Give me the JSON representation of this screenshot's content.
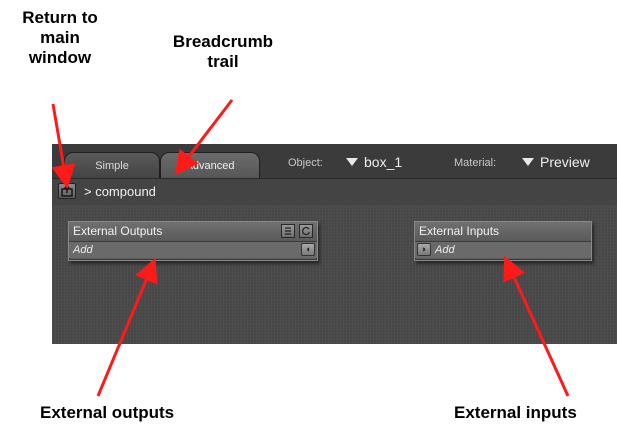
{
  "callouts": {
    "return_to_main": "Return to\nmain\nwindow",
    "breadcrumb_trail": "Breadcrumb\ntrail",
    "external_outputs": "External outputs",
    "external_inputs": "External inputs"
  },
  "toolbar": {
    "tabs": [
      {
        "label": "Simple"
      },
      {
        "label": "Advanced"
      }
    ],
    "object_label": "Object:",
    "object_value": "box_1",
    "material_label": "Material:",
    "material_value": "Preview"
  },
  "breadcrumb": {
    "text": "> compound"
  },
  "nodes": {
    "external_outputs": {
      "title": "External Outputs",
      "row_label": "Add"
    },
    "external_inputs": {
      "title": "External Inputs",
      "row_label": "Add"
    }
  },
  "colors": {
    "arrow": "#ff1a1a",
    "panel_bg": "#4a4a4a",
    "node_bg": "#5d5d5d"
  },
  "icons": [
    "return-to-main-icon",
    "dropdown-triangle-icon",
    "list-icon",
    "refresh-icon",
    "port-connector-icon"
  ]
}
